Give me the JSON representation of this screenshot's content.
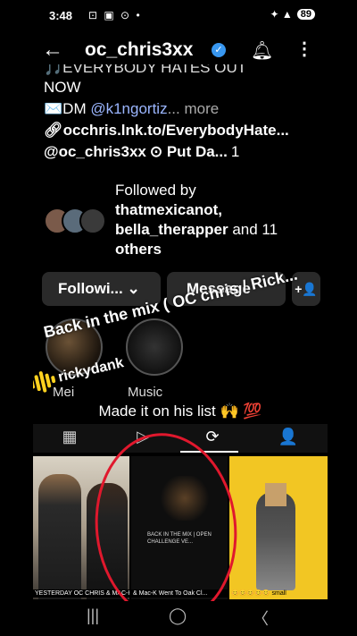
{
  "status": {
    "time": "3:48",
    "left_icons": "⊡ ▣ ⊙ •",
    "right_icons": "✦ ▲",
    "battery": "89"
  },
  "header": {
    "username": "oc_chris3xx"
  },
  "bio": {
    "line1": "🎵EVERYBODY HATES OUT",
    "line2": "NOW",
    "dm_prefix": "✉️DM ",
    "dm_handle": "@k1ngortiz",
    "more": "... more",
    "link": "occhris.lnk.to/EverybodyHate...",
    "threads_handle": "@oc_chris3xx",
    "threads_song": "⊙ Put Da...",
    "threads_count": "1"
  },
  "followed_by": {
    "line1": "Followed by",
    "line2": "thatmexicanot,",
    "line3_a": "bella_therapper",
    "line3_b": " and 11",
    "line4": "others"
  },
  "buttons": {
    "following": "Followi... ⌄",
    "message": "Message",
    "add_user": "+👤"
  },
  "highlights": [
    {
      "label": "Mei"
    },
    {
      "label": "Music"
    }
  ],
  "overlay": {
    "text": "Back in the mix ( OC chris / Rick...",
    "badge": "rickydank"
  },
  "caption": "Made it on his list 🙌 💯",
  "tabs": [
    {
      "icon": "▦"
    },
    {
      "icon": "▷"
    },
    {
      "icon": "⟳"
    },
    {
      "icon": "👤"
    }
  ],
  "grid": [
    {
      "caption": "YESTERDAY OC CHRIS & MAC-K WENT TO"
    },
    {
      "center": "BACK IN THE MIX | OPEN CHALLENGE VE...",
      "caption": "& Mac-K Went To Oak Cl..."
    },
    {
      "caption": "😊😊😊😊😊 small"
    }
  ],
  "nav": {
    "recent": "|||",
    "home": "◯",
    "back": "〈"
  },
  "colors": {
    "accent_red": "#e0182d",
    "verified": "#3897f0",
    "mention": "#9bb6ff"
  }
}
